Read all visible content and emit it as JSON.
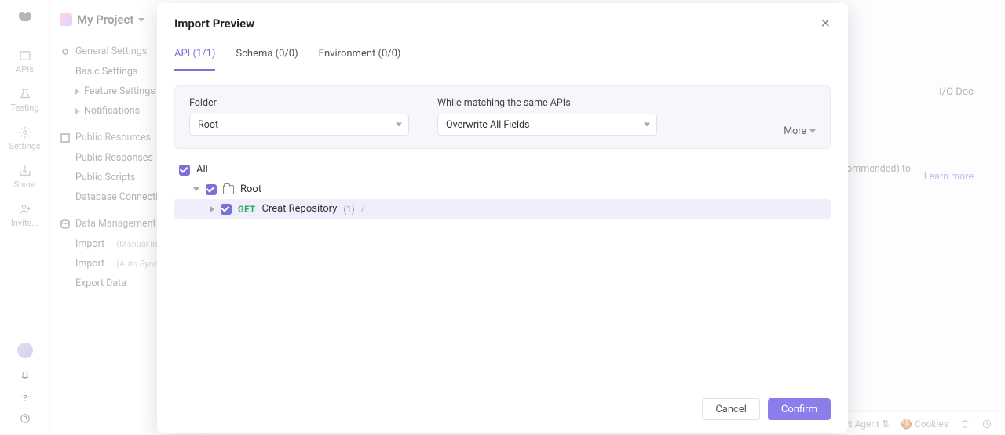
{
  "project": {
    "name": "My Project"
  },
  "rail": {
    "apis": "APIs",
    "testing": "Testing",
    "settings": "Settings",
    "share": "Share",
    "invite": "Invite..."
  },
  "sidebar": {
    "general": "General Settings",
    "basic": "Basic Settings",
    "feature": "Feature Settings",
    "notifications": "Notifications",
    "publicRes": "Public Resources",
    "publicResp": "Public Responses",
    "publicScripts": "Public Scripts",
    "dbConn": "Database Connections",
    "dataMgmt": "Data Management",
    "import1": "Import",
    "import1b": "(Manual Import)",
    "import2": "Import",
    "import2b": "(Auto Sync)",
    "export": "Export Data"
  },
  "main": {
    "iodoc": "I/O Doc",
    "recommended": "(ommended)  to",
    "learn": "Learn more"
  },
  "statusbar": {
    "agent": "Select Agent",
    "cookies": "Cookies"
  },
  "modal": {
    "title": "Import Preview",
    "tabs": {
      "api": "API (1/1)",
      "schema": "Schema (0/0)",
      "env": "Environment (0/0)"
    },
    "folderLabel": "Folder",
    "folderValue": "Root",
    "matchLabel": "While matching the same APIs",
    "matchValue": "Overwrite All Fields",
    "more": "More",
    "all": "All",
    "root": "Root",
    "api1": {
      "method": "GET",
      "name": "Creat Repository",
      "count": "(1)",
      "path": "/"
    },
    "cancel": "Cancel",
    "confirm": "Confirm"
  }
}
